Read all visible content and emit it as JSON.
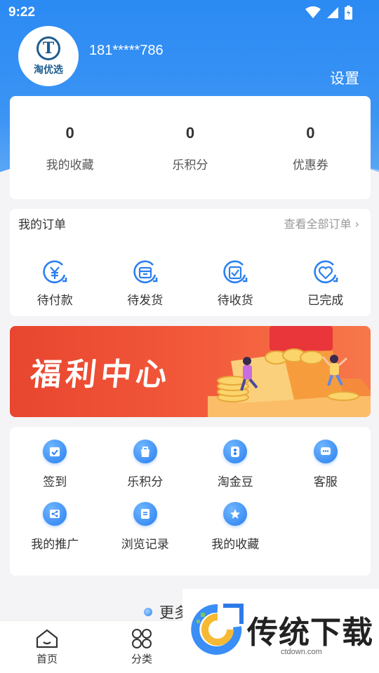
{
  "status_bar": {
    "time": "9:22"
  },
  "profile": {
    "avatar_logo_letter": "T",
    "avatar_brand": "淘优选",
    "phone": "181*****786",
    "settings_label": "设置"
  },
  "stats": [
    {
      "value": "0",
      "label": "我的收藏"
    },
    {
      "value": "0",
      "label": "乐积分"
    },
    {
      "value": "0",
      "label": "优惠券"
    }
  ],
  "orders": {
    "title": "我的订单",
    "view_all": "查看全部订单",
    "items": [
      {
        "label": "待付款",
        "icon": "yen-icon"
      },
      {
        "label": "待发货",
        "icon": "package-icon"
      },
      {
        "label": "待收货",
        "icon": "receive-icon"
      },
      {
        "label": "已完成",
        "icon": "heart-icon"
      }
    ]
  },
  "banner": {
    "title": "福利中心"
  },
  "services": [
    {
      "label": "签到",
      "icon": "calendar-check-icon"
    },
    {
      "label": "乐积分",
      "icon": "bag-icon"
    },
    {
      "label": "淘金豆",
      "icon": "coin-icon"
    },
    {
      "label": "客服",
      "icon": "chat-icon"
    },
    {
      "label": "我的推广",
      "icon": "share-icon"
    },
    {
      "label": "浏览记录",
      "icon": "history-icon"
    },
    {
      "label": "我的收藏",
      "icon": "star-icon"
    }
  ],
  "more_label": "更多",
  "bottom_nav": [
    {
      "label": "首页",
      "icon": "home-icon"
    },
    {
      "label": "分类",
      "icon": "category-icon"
    }
  ],
  "watermark": {
    "title": "传统下载",
    "url": "ctdown.com"
  },
  "colors": {
    "primary": "#2b8af3",
    "banner": "#f2583a"
  }
}
